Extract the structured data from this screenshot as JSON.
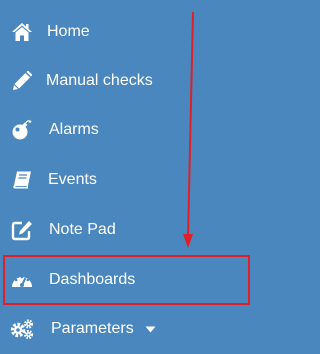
{
  "colors": {
    "background": "#4a87bf",
    "text": "#ffffff",
    "annotation": "#e01f26"
  },
  "menu": {
    "items": [
      {
        "label": "Home",
        "icon": "home-icon"
      },
      {
        "label": "Manual checks",
        "icon": "pencil-icon"
      },
      {
        "label": "Alarms",
        "icon": "bomb-icon"
      },
      {
        "label": "Events",
        "icon": "book-icon"
      },
      {
        "label": "Note Pad",
        "icon": "edit-icon"
      },
      {
        "label": "Dashboards",
        "icon": "tachometer-icon",
        "highlighted": true
      },
      {
        "label": "Parameters",
        "icon": "cogs-icon",
        "has_dropdown": true
      }
    ]
  }
}
